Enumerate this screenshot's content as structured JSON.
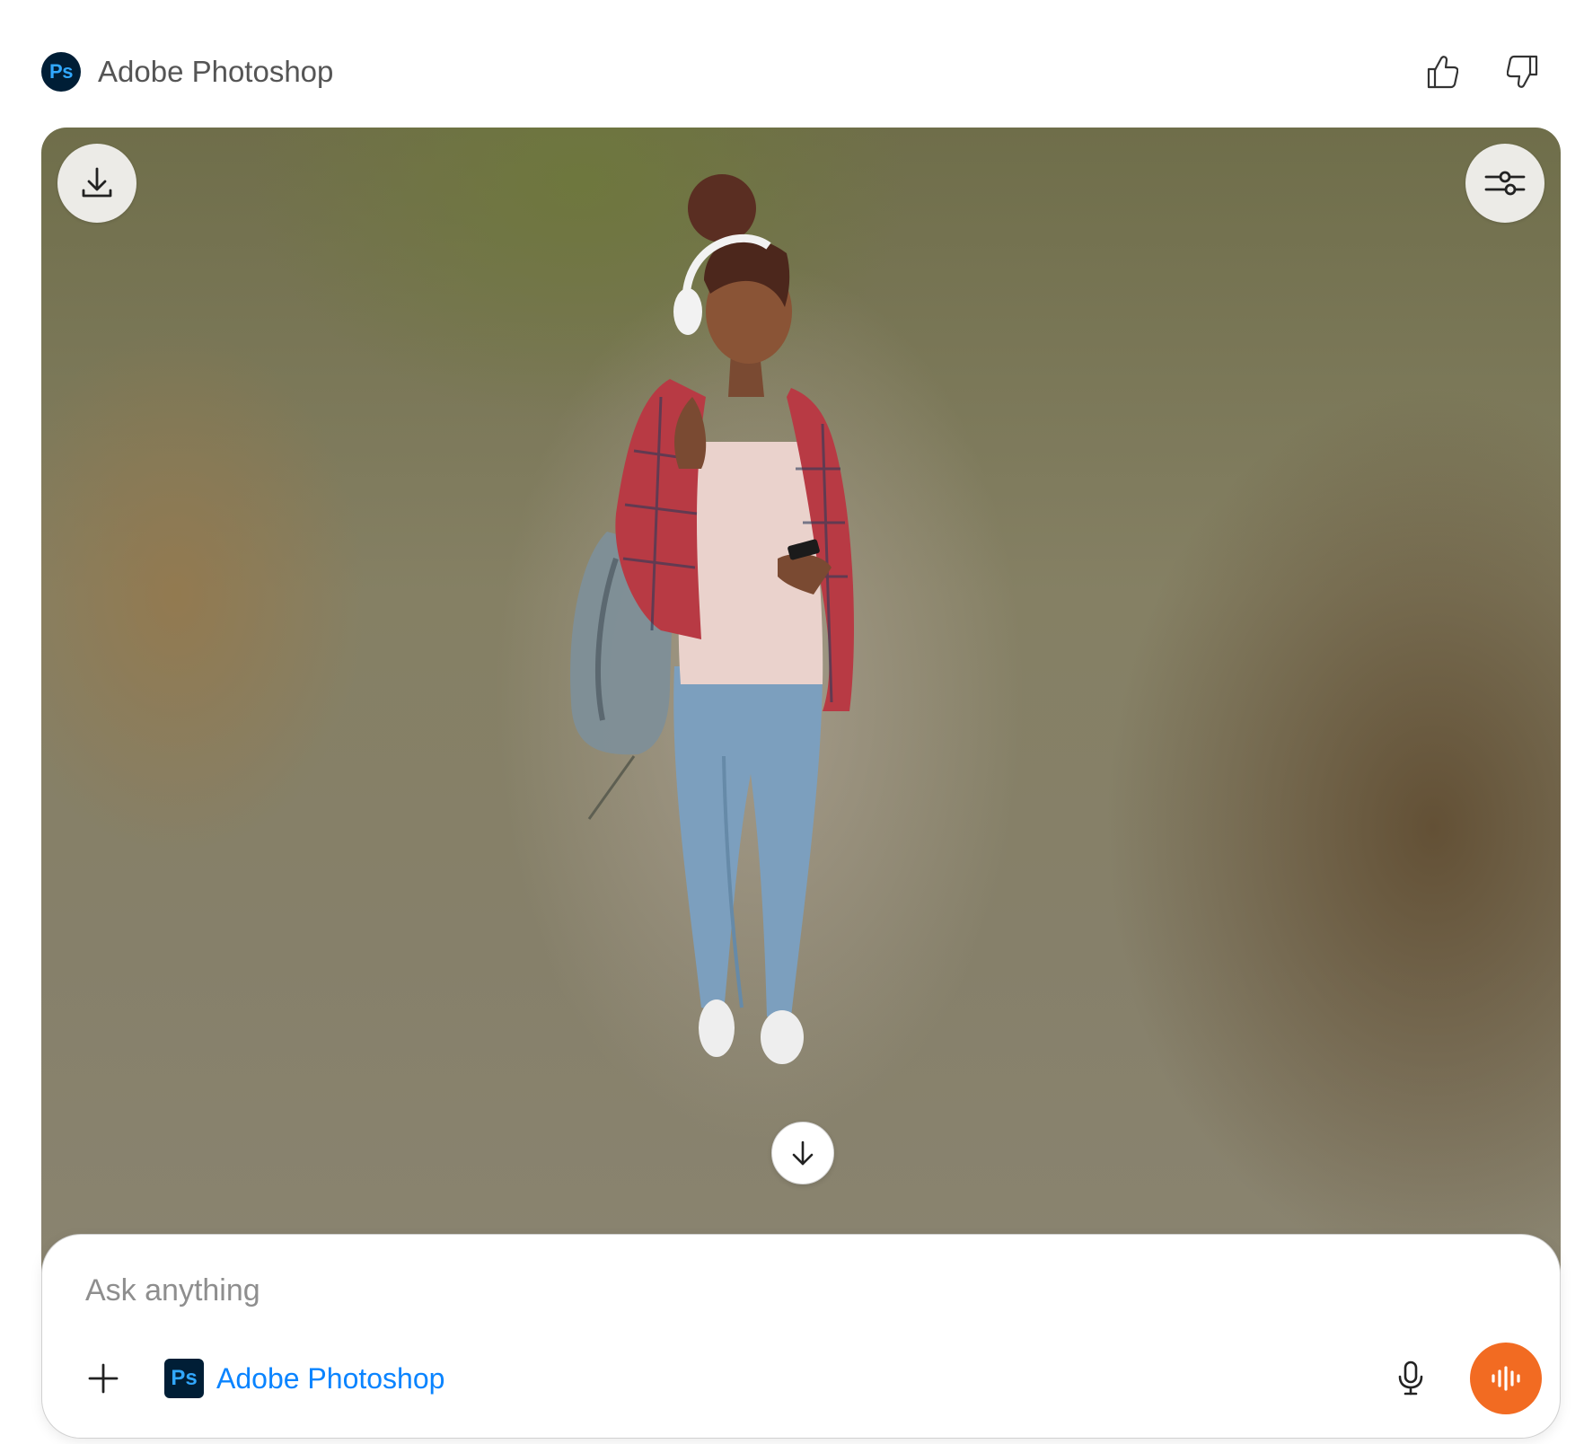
{
  "header": {
    "app_badge": "Ps",
    "app_title": "Adobe Photoshop",
    "thumbs_up_icon": "thumbs-up-icon",
    "thumbs_down_icon": "thumbs-down-icon"
  },
  "canvas": {
    "download_icon": "download-icon",
    "adjust_icon": "sliders-icon",
    "scroll_down_icon": "arrow-down-icon"
  },
  "composer": {
    "placeholder": "Ask anything",
    "value": "",
    "tool_badge": "Ps",
    "tool_label": "Adobe Photoshop",
    "plus_icon": "plus-icon",
    "mic_icon": "microphone-icon",
    "voice_icon": "voice-waveform-icon"
  },
  "colors": {
    "accent_orange": "#f26b22",
    "link_blue": "#0a84ff",
    "ps_dark": "#001e36",
    "ps_blue": "#31a8ff"
  }
}
